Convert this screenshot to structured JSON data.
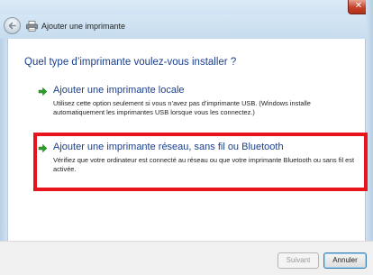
{
  "window": {
    "close_glyph": "✕"
  },
  "navbar": {
    "title": "Ajouter une imprimante",
    "back_icon": "back-arrow-icon",
    "printer_icon": "printer-icon"
  },
  "main": {
    "heading": "Quel type d’imprimante voulez-vous installer ?",
    "options": [
      {
        "title": "Ajouter une imprimante locale",
        "description": "Utilisez cette option seulement si vous n’avez pas d’imprimante USB. (Windows installe automatiquement les imprimantes USB lorsque vous les connectez.)",
        "icon": "green-arrow-icon"
      },
      {
        "title": "Ajouter une imprimante réseau, sans fil ou Bluetooth",
        "description": "Vérifiez que votre ordinateur est connecté au réseau ou que votre imprimante Bluetooth ou sans fil est activée.",
        "icon": "green-arrow-icon",
        "highlighted": true
      }
    ]
  },
  "footer": {
    "next_label": "Suivant",
    "next_enabled": false,
    "cancel_label": "Annuler"
  },
  "colors": {
    "link_blue": "#1b3f8c",
    "highlight_red": "#e8141c",
    "arrow_green": "#2e9e2a"
  }
}
